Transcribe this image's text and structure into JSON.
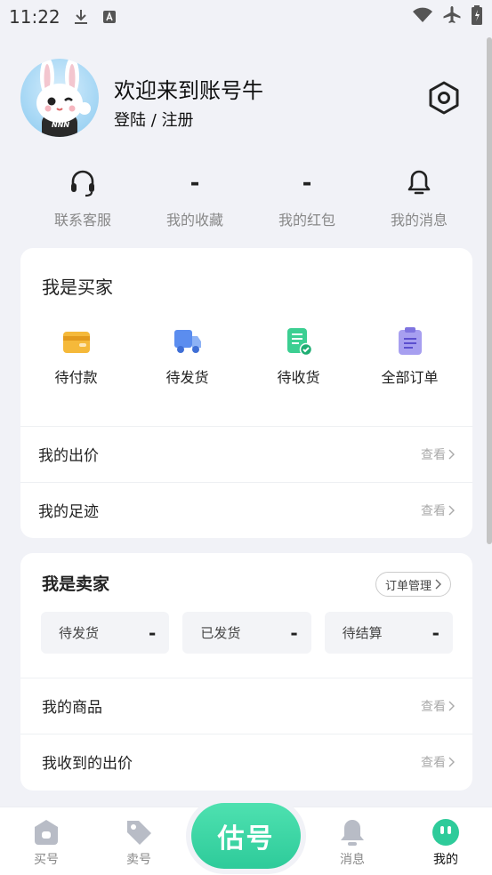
{
  "status_bar": {
    "time": "11:22",
    "icons": [
      "download-icon",
      "keyboard-a-icon",
      "wifi-icon",
      "airplane-mode-icon",
      "battery-icon"
    ]
  },
  "profile": {
    "welcome": "欢迎来到账号牛",
    "login_register": "登陆 / 注册",
    "avatar_shirt_text": "NNN"
  },
  "stats": [
    {
      "icon": "headset-icon",
      "value": "",
      "label": "联系客服"
    },
    {
      "icon": "",
      "value": "-",
      "label": "我的收藏"
    },
    {
      "icon": "",
      "value": "-",
      "label": "我的红包"
    },
    {
      "icon": "bell-icon",
      "value": "",
      "label": "我的消息"
    }
  ],
  "buyer": {
    "title": "我是买家",
    "orders": [
      {
        "icon": "wallet-icon",
        "label": "待付款"
      },
      {
        "icon": "delivery-truck-icon",
        "label": "待发货"
      },
      {
        "icon": "receipt-check-icon",
        "label": "待收货"
      },
      {
        "icon": "clipboard-list-icon",
        "label": "全部订单"
      }
    ],
    "rows": [
      {
        "label": "我的出价",
        "link": "查看"
      },
      {
        "label": "我的足迹",
        "link": "查看"
      }
    ]
  },
  "seller": {
    "title": "我是卖家",
    "order_mgmt": "订单管理",
    "boxes": [
      {
        "label": "待发货",
        "value": "-"
      },
      {
        "label": "已发货",
        "value": "-"
      },
      {
        "label": "待结算",
        "value": "-"
      }
    ],
    "rows": [
      {
        "label": "我的商品",
        "link": "查看"
      },
      {
        "label": "我收到的出价",
        "link": "查看"
      }
    ]
  },
  "tabbar": {
    "tabs": [
      {
        "label": "买号",
        "icon": "shopping-bag-icon",
        "active": false
      },
      {
        "label": "卖号",
        "icon": "price-tag-icon",
        "active": false
      },
      {
        "label": "消息",
        "icon": "bell-icon",
        "active": false
      },
      {
        "label": "我的",
        "icon": "smiley-face-icon",
        "active": true
      }
    ],
    "center_button": "估号"
  },
  "colors": {
    "accent": "#2ecb9a",
    "background": "#f1f2f7",
    "wallet": "#f5b93a",
    "truck": "#5b8def",
    "receipt": "#3ccf92",
    "clipboard": "#8f86ea"
  }
}
